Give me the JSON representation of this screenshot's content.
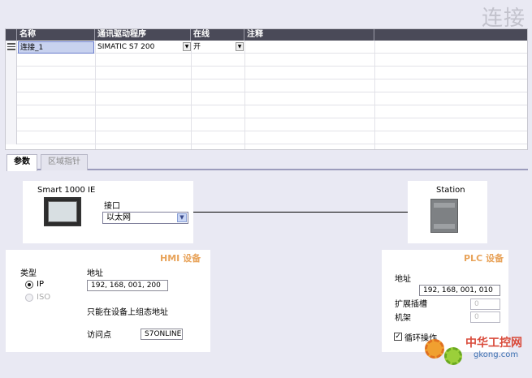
{
  "page": {
    "title": "连接"
  },
  "grid": {
    "columns": [
      "名称",
      "通讯驱动程序",
      "在线",
      "注释"
    ],
    "rows": [
      {
        "name": "连接_1",
        "driver": "SIMATIC S7 200",
        "online": "开",
        "comment": ""
      }
    ]
  },
  "tabs": [
    {
      "label": "参数",
      "active": true
    },
    {
      "label": "区域指针",
      "active": false
    }
  ],
  "device": {
    "hmi_name": "Smart 1000 IE",
    "interface_label": "接口",
    "interface_value": "以太网",
    "station_label": "Station"
  },
  "hmi": {
    "title": "HMI 设备",
    "type_label": "类型",
    "type_options": [
      {
        "label": "IP",
        "selected": true
      },
      {
        "label": "ISO",
        "selected": false
      }
    ],
    "address_label": "地址",
    "address_value": "192, 168, 001, 200",
    "note": "只能在设备上组态地址",
    "access_point_label": "访问点",
    "access_point_value": "S7ONLINE"
  },
  "plc": {
    "title": "PLC 设备",
    "address_label": "地址",
    "address_value": "192, 168, 001, 010",
    "ext_slot_label": "扩展插槽",
    "ext_slot_value": "0",
    "rack_label": "机架",
    "rack_value": "0",
    "cyclic_label": "循环操作",
    "cyclic_checked": true
  },
  "watermark": {
    "cn": "中华工控网",
    "en": "gkong.com"
  },
  "colors": {
    "header_bg": "#4a4a58",
    "panel_title": "#e8a35a",
    "selection": "#c8d2ef"
  }
}
